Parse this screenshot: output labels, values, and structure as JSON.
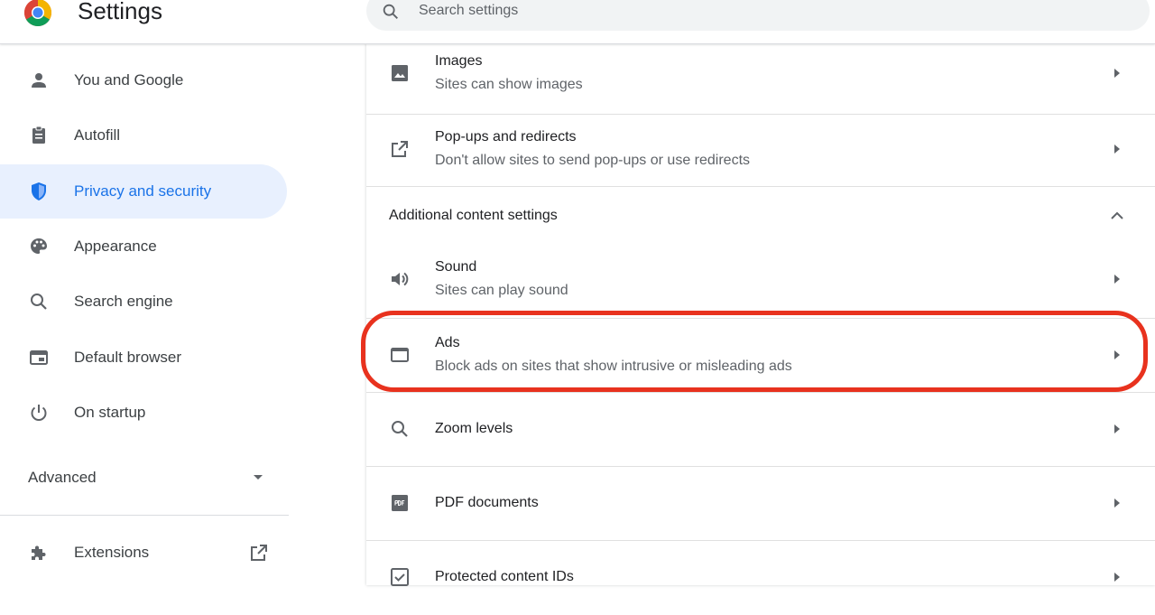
{
  "header": {
    "title": "Settings",
    "logo_icon": "chrome-logo-icon",
    "search_placeholder": "Search settings"
  },
  "sidebar": {
    "items": [
      {
        "label": "You and Google",
        "icon": "person-icon",
        "selected": false
      },
      {
        "label": "Autofill",
        "icon": "clipboard-icon",
        "selected": false
      },
      {
        "label": "Privacy and security",
        "icon": "shield-icon",
        "selected": true
      },
      {
        "label": "Appearance",
        "icon": "palette-icon",
        "selected": false
      },
      {
        "label": "Search engine",
        "icon": "search-icon",
        "selected": false
      },
      {
        "label": "Default browser",
        "icon": "browser-icon",
        "selected": false
      },
      {
        "label": "On startup",
        "icon": "power-icon",
        "selected": false
      }
    ],
    "advanced_label": "Advanced",
    "extensions_label": "Extensions"
  },
  "content": {
    "rows_top": [
      {
        "title": "Images",
        "subtitle": "Sites can show images",
        "icon": "image-icon"
      },
      {
        "title": "Pop-ups and redirects",
        "subtitle": "Don't allow sites to send pop-ups or use redirects",
        "icon": "open-in-new-icon"
      }
    ],
    "section_title": "Additional content settings",
    "rows_additional": [
      {
        "title": "Sound",
        "subtitle": "Sites can play sound",
        "icon": "volume-icon"
      },
      {
        "title": "Ads",
        "subtitle": "Block ads on sites that show intrusive or misleading ads",
        "icon": "ads-window-icon",
        "highlighted": true
      },
      {
        "title": "Zoom levels",
        "icon": "zoom-icon"
      },
      {
        "title": "PDF documents",
        "icon": "pdf-icon"
      },
      {
        "title": "Protected content IDs",
        "icon": "checkbox-icon"
      }
    ]
  },
  "colors": {
    "accent": "#1a73e8",
    "selected_bg": "#e8f0fe",
    "highlight_ring": "#e8321e"
  }
}
